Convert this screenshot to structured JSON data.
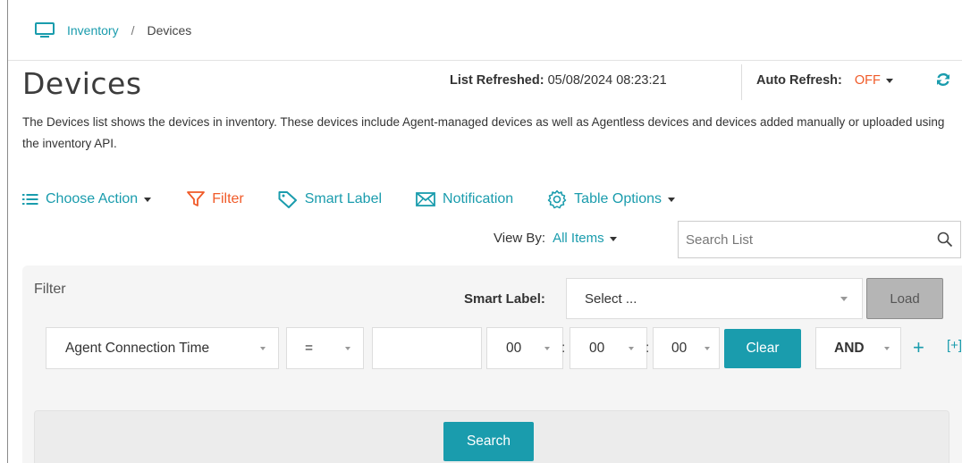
{
  "breadcrumb": {
    "icon": "monitor-icon",
    "parent": "Inventory",
    "separator": "/",
    "current": "Devices"
  },
  "page": {
    "title": "Devices",
    "description": "The Devices list shows the devices in inventory. These devices include Agent-managed devices as well as Agentless devices and devices added manually or uploaded using the inventory API."
  },
  "refresh": {
    "list_refreshed_label": "List Refreshed:",
    "list_refreshed_value": "05/08/2024 08:23:21",
    "auto_refresh_label": "Auto Refresh:",
    "auto_refresh_value": "OFF",
    "icon": "sync-icon"
  },
  "toolbar": {
    "choose_action": "Choose Action",
    "filter": "Filter",
    "smart_label": "Smart Label",
    "notification": "Notification",
    "table_options": "Table Options"
  },
  "view_by": {
    "label": "View By:",
    "value": "All Items"
  },
  "search": {
    "placeholder": "Search List"
  },
  "filter_panel": {
    "title": "Filter",
    "smart_label_label": "Smart Label:",
    "smart_label_value": "Select ...",
    "load_label": "Load",
    "field_value": "Agent Connection Time",
    "operator_value": "=",
    "text_value": "",
    "hour_value": "00",
    "minute_value": "00",
    "second_value": "00",
    "time_separator": ":",
    "clear_label": "Clear",
    "conjunction_value": "AND",
    "add_label": "+",
    "add_group_label": "[+]",
    "search_label": "Search"
  },
  "colors": {
    "accent": "#1a9cad",
    "highlight": "#f05a28",
    "panel_bg": "#f5f5f5"
  }
}
